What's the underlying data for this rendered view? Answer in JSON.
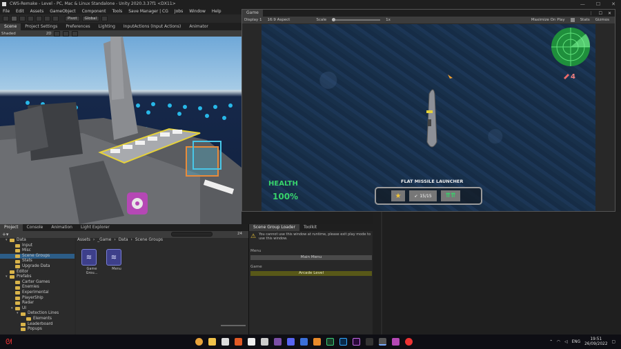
{
  "window": {
    "title": "CWS-Remake - Level - PC, Mac & Linux Standalone - Unity 2020.3.37f1 <DX11>",
    "controls": [
      "—",
      "☐",
      "✕"
    ]
  },
  "menu": [
    "File",
    "Edit",
    "Assets",
    "GameObject",
    "Component",
    "Tools",
    "Save Manager | CG",
    "Jobs",
    "Window",
    "Help"
  ],
  "toolbar": {
    "pivot": "Pivot",
    "global": "Global"
  },
  "scene_tabs": [
    "Scene",
    "Project Settings",
    "Preferences",
    "Lighting",
    "InputActions (Input Actions)",
    "Animator"
  ],
  "scene_bar": {
    "shading": "Shaded",
    "zoom": "2D"
  },
  "game": {
    "tab": "Game",
    "display": "Display 1",
    "aspect": "16:9 Aspect",
    "scale_label": "Scale",
    "scale_value": "1x",
    "maximize": "Maximize On Play",
    "stats": "Stats",
    "gizmos": "Gizmos",
    "win_controls": [
      "⋮",
      "☐",
      "✕"
    ],
    "health_label": "HEALTH",
    "health_value": "100%",
    "weapon_name": "FLAT MISSILE LAUNCHER",
    "ammo": "15/15",
    "missiles_count": "4"
  },
  "project": {
    "tabs": [
      "Project",
      "Console",
      "Animation",
      "Light Explorer"
    ],
    "count": "24",
    "tree": [
      {
        "label": "Data",
        "depth": 1,
        "open": true
      },
      {
        "label": "Input",
        "depth": 2
      },
      {
        "label": "Misc",
        "depth": 2
      },
      {
        "label": "Scene Groups",
        "depth": 2,
        "selected": true
      },
      {
        "label": "Stats",
        "depth": 2
      },
      {
        "label": "Upgrade Data",
        "depth": 2
      },
      {
        "label": "Editor",
        "depth": 1
      },
      {
        "label": "Prefabs",
        "depth": 1,
        "open": true
      },
      {
        "label": "Carter Games",
        "depth": 2
      },
      {
        "label": "Enemies",
        "depth": 2
      },
      {
        "label": "Experimental",
        "depth": 2
      },
      {
        "label": "PlayerShip",
        "depth": 2
      },
      {
        "label": "Radar",
        "depth": 2
      },
      {
        "label": "UI",
        "depth": 2,
        "open": true
      },
      {
        "label": "Detection Lines",
        "depth": 3,
        "open": true
      },
      {
        "label": "Elements",
        "depth": 4
      },
      {
        "label": "Leaderboard",
        "depth": 3
      },
      {
        "label": "Popups",
        "depth": 3
      }
    ],
    "breadcrumb": [
      "Assets",
      "_Game",
      "Data",
      "Scene Groups"
    ],
    "assets": [
      {
        "label": "Game Grou..."
      },
      {
        "label": "Menu"
      }
    ]
  },
  "scene_group_loader": {
    "tabs": [
      "Scene Group Loader",
      "Toolkit"
    ],
    "warning": "You cannot use this window at runtime, please exit play mode to use this window.",
    "sections": [
      {
        "title": "Menu",
        "button": "Main Menu"
      },
      {
        "title": "Game",
        "button": "Arcade Level"
      }
    ]
  },
  "taskbar": {
    "time": "19:51",
    "date": "26/09/2022",
    "lang": "ENG"
  },
  "colors": {
    "health": "#37d36b",
    "highlight": "#e6d23a",
    "selected_row": "#2c5d87",
    "arcade_btn": "#585818"
  }
}
